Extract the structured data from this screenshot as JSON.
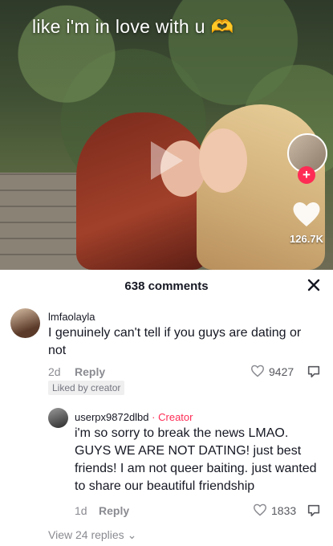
{
  "video": {
    "caption": "like i'm in love with u 🫶",
    "like_count": "126.7K"
  },
  "comments_panel": {
    "title": "638 comments",
    "comments": [
      {
        "username": "lmfaolayla",
        "text": "I genuinely can't tell if you guys are dating or not",
        "age": "2d",
        "reply_label": "Reply",
        "likes": "9427",
        "badge": "Liked by creator"
      }
    ],
    "reply": {
      "username": "userpx9872dlbd",
      "separator": "·",
      "creator_tag": "Creator",
      "text": "i'm so sorry to break the news LMAO. GUYS WE ARE NOT DATING! just best friends! I am not queer baiting. just wanted to share our beautiful friendship",
      "age": "1d",
      "reply_label": "Reply",
      "likes": "1833"
    },
    "view_replies": "View 24 replies"
  },
  "colors": {
    "accent": "#fe2c55",
    "text": "#161823",
    "muted": "#8a8b91"
  },
  "icons": [
    "play-icon",
    "heart-icon",
    "close-icon",
    "reply-icon"
  ]
}
